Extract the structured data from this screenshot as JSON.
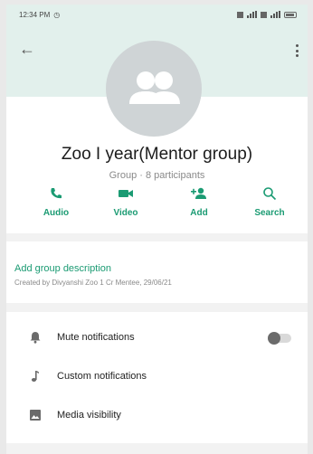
{
  "status_bar": {
    "time": "12:34 PM"
  },
  "group": {
    "name": "Zoo I year(Mentor group)",
    "subtitle": "Group · 8 participants"
  },
  "actions": [
    {
      "label": "Audio",
      "icon": "phone-icon"
    },
    {
      "label": "Video",
      "icon": "video-camera-icon"
    },
    {
      "label": "Add",
      "icon": "add-person-icon"
    },
    {
      "label": "Search",
      "icon": "search-icon"
    }
  ],
  "description": {
    "add_label": "Add group description",
    "created_by": "Created by Divyanshi Zoo 1 Cr Mentee, 29/06/21"
  },
  "settings": [
    {
      "label": "Mute notifications",
      "icon": "bell-icon",
      "toggle": false
    },
    {
      "label": "Custom notifications",
      "icon": "music-note-icon"
    },
    {
      "label": "Media visibility",
      "icon": "image-icon"
    }
  ],
  "colors": {
    "accent": "#1b9b73",
    "header_bg": "#e2f0ec"
  }
}
